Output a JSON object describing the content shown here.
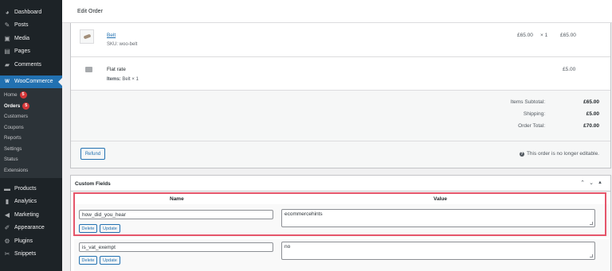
{
  "sidebar": {
    "top_items": [
      {
        "label": "Dashboard",
        "icon": "dashboard-icon",
        "glyph": "◕"
      },
      {
        "label": "Posts",
        "icon": "pin-icon",
        "glyph": "✎"
      },
      {
        "label": "Media",
        "icon": "media-icon",
        "glyph": "▣"
      },
      {
        "label": "Pages",
        "icon": "pages-icon",
        "glyph": "▤"
      },
      {
        "label": "Comments",
        "icon": "comments-icon",
        "glyph": "▰"
      }
    ],
    "woocommerce": {
      "label": "WooCommerce",
      "icon": "woocommerce-icon",
      "glyph": "W"
    },
    "submenu": [
      {
        "label": "Home",
        "badge": "5"
      },
      {
        "label": "Orders",
        "badge": "5"
      },
      {
        "label": "Customers"
      },
      {
        "label": "Coupons"
      },
      {
        "label": "Reports"
      },
      {
        "label": "Settings"
      },
      {
        "label": "Status"
      },
      {
        "label": "Extensions"
      }
    ],
    "bottom_items": [
      {
        "label": "Products",
        "icon": "products-icon",
        "glyph": "▬"
      },
      {
        "label": "Analytics",
        "icon": "analytics-icon",
        "glyph": "▮"
      },
      {
        "label": "Marketing",
        "icon": "megaphone-icon",
        "glyph": "◀"
      },
      {
        "label": "Appearance",
        "icon": "brush-icon",
        "glyph": "✐"
      },
      {
        "label": "Plugins",
        "icon": "plugin-icon",
        "glyph": "⚙"
      },
      {
        "label": "Snippets",
        "icon": "scissors-icon",
        "glyph": "✂"
      }
    ]
  },
  "header": {
    "title": "Edit Order"
  },
  "order": {
    "item": {
      "name": "Belt",
      "sku": "SKU: woo-belt",
      "cost": "£65.00",
      "qty": "× 1",
      "total": "£65.00"
    },
    "shipping": {
      "name": "Flat rate",
      "items_label": "Items:",
      "items_value": "Belt × 1",
      "total": "£5.00"
    },
    "totals": [
      {
        "label": "Items Subtotal:",
        "value": "£65.00"
      },
      {
        "label": "Shipping:",
        "value": "£5.00"
      },
      {
        "label": "Order Total:",
        "value": "£70.00"
      }
    ],
    "refund_label": "Refund",
    "note": "This order is no longer editable."
  },
  "custom_fields": {
    "title": "Custom Fields",
    "col_name": "Name",
    "col_value": "Value",
    "rows": [
      {
        "key": "how_did_you_hear",
        "value": "ecommercehints",
        "delete": "Delete",
        "update": "Update"
      },
      {
        "key": "is_vat_exempt",
        "value": "no",
        "delete": "Delete",
        "update": "Update"
      }
    ]
  },
  "colors": {
    "sidebar": "#1d2327",
    "accent": "#2271b1",
    "badge": "#d63638",
    "highlight": "#e5556a"
  }
}
